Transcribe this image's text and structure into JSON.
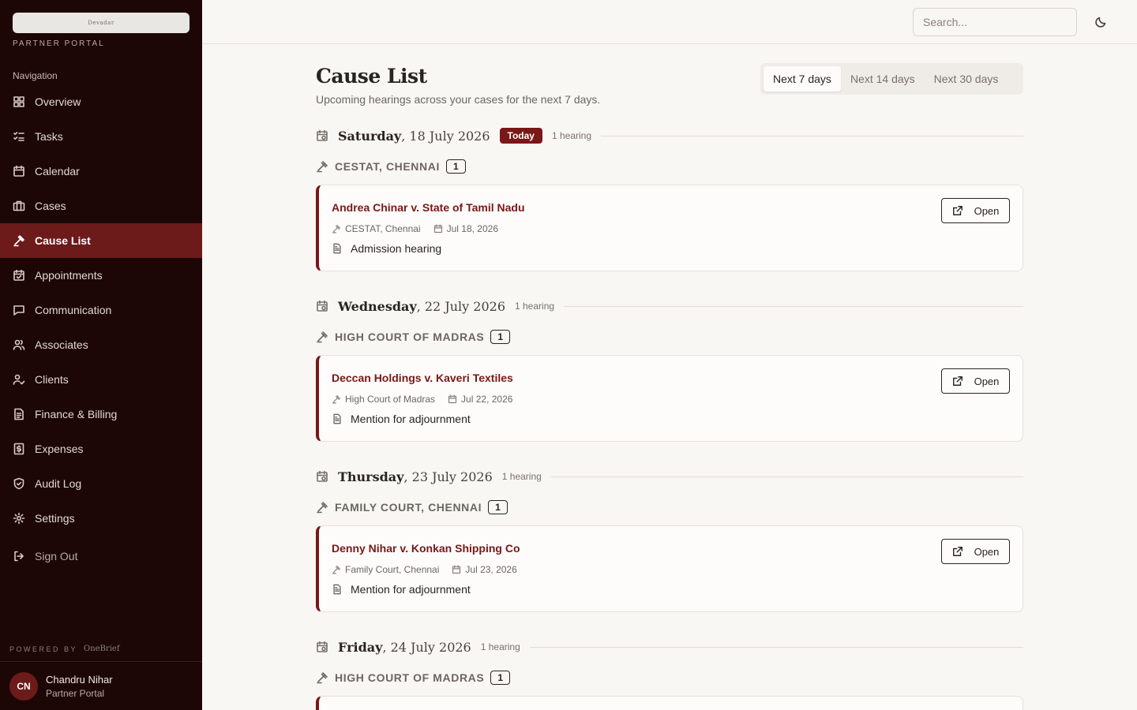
{
  "sidebar": {
    "logo_text": "Devadar",
    "portal_label": "PARTNER PORTAL",
    "nav_heading": "Navigation",
    "items": [
      {
        "label": "Overview",
        "icon": "dashboard-icon"
      },
      {
        "label": "Tasks",
        "icon": "checklist-icon"
      },
      {
        "label": "Calendar",
        "icon": "calendar-icon"
      },
      {
        "label": "Cases",
        "icon": "briefcase-icon"
      },
      {
        "label": "Cause List",
        "icon": "gavel-icon",
        "active": true
      },
      {
        "label": "Appointments",
        "icon": "calendar-check-icon"
      },
      {
        "label": "Communication",
        "icon": "message-icon"
      },
      {
        "label": "Associates",
        "icon": "users-icon"
      },
      {
        "label": "Clients",
        "icon": "user-check-icon"
      },
      {
        "label": "Finance & Billing",
        "icon": "receipt-icon"
      },
      {
        "label": "Expenses",
        "icon": "dollar-receipt-icon"
      },
      {
        "label": "Audit Log",
        "icon": "shield-icon"
      },
      {
        "label": "Settings",
        "icon": "gear-icon"
      }
    ],
    "sign_out": "Sign Out",
    "powered_by": "POWERED BY",
    "powered_brand": "OneBrief",
    "user": {
      "initials": "CN",
      "name": "Chandru Nihar",
      "role": "Partner Portal"
    }
  },
  "topbar": {
    "search_placeholder": "Search...",
    "theme_icon": "moon-icon"
  },
  "main": {
    "title": "Cause List",
    "subtitle": "Upcoming hearings across your cases for the next 7 days.",
    "range_tabs": [
      {
        "label": "Next 7 days",
        "active": true
      },
      {
        "label": "Next 14 days"
      },
      {
        "label": "Next 30 days"
      }
    ],
    "days": [
      {
        "weekday": "Saturday",
        "date": ", 18 July 2026",
        "badge": "Today",
        "count": "1 hearing",
        "court": "CESTAT, CHENNAI",
        "court_count": "1",
        "case": {
          "title": "Andrea Chinar v. State of Tamil Nadu",
          "court": "CESTAT, Chennai",
          "date": "Jul 18, 2026",
          "purpose": "Admission hearing",
          "open_label": "Open"
        }
      },
      {
        "weekday": "Wednesday",
        "date": ", 22 July 2026",
        "count": "1 hearing",
        "court": "HIGH COURT OF MADRAS",
        "court_count": "1",
        "case": {
          "title": "Deccan Holdings v. Kaveri Textiles",
          "court": "High Court of Madras",
          "date": "Jul 22, 2026",
          "purpose": "Mention for adjournment",
          "open_label": "Open"
        }
      },
      {
        "weekday": "Thursday",
        "date": ", 23 July 2026",
        "count": "1 hearing",
        "court": "FAMILY COURT, CHENNAI",
        "court_count": "1",
        "case": {
          "title": "Denny Nihar v. Konkan Shipping Co",
          "court": "Family Court, Chennai",
          "date": "Jul 23, 2026",
          "purpose": "Mention for adjournment",
          "open_label": "Open"
        }
      },
      {
        "weekday": "Friday",
        "date": ", 24 July 2026",
        "count": "1 hearing",
        "court": "HIGH COURT OF MADRAS",
        "court_count": "1"
      }
    ]
  },
  "colors": {
    "sidebar_bg": "#1c0706",
    "accent": "#7a1717",
    "active_nav": "#6d1a1a",
    "page_bg": "#f8f7f4"
  }
}
